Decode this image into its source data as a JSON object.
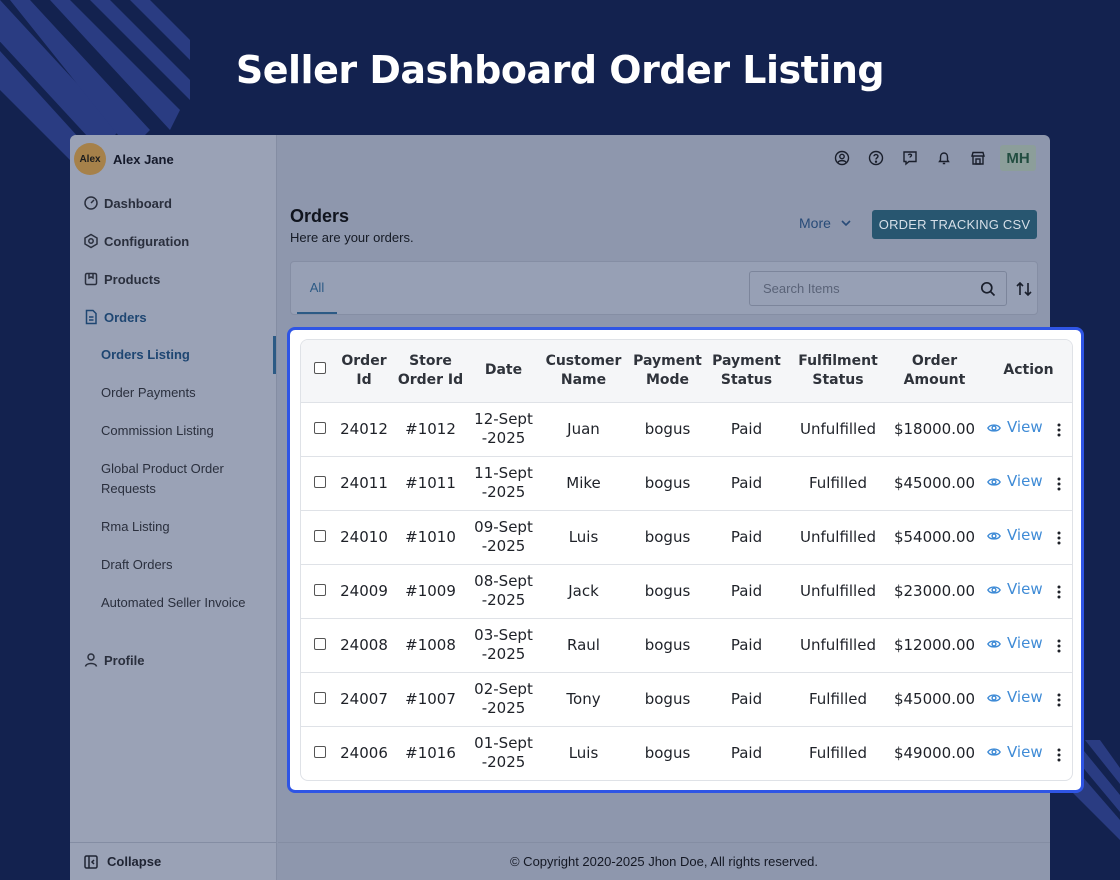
{
  "page": {
    "title": "Seller Dashboard Order Listing",
    "background": "#13224f",
    "highlight_color": "#2f55e5"
  },
  "sidebar": {
    "user": {
      "avatar_text": "Alex",
      "name": "Alex Jane"
    },
    "items": [
      {
        "label": "Dashboard",
        "icon": "dashboard-icon"
      },
      {
        "label": "Configuration",
        "icon": "gear-icon"
      },
      {
        "label": "Products",
        "icon": "product-icon"
      },
      {
        "label": "Orders",
        "icon": "document-icon"
      }
    ],
    "orders_subitems": [
      "Orders Listing",
      "Order Payments",
      "Commission Listing",
      "Global Product Order Requests",
      "Rma Listing",
      "Draft Orders",
      "Automated Seller Invoice"
    ],
    "profile_label": "Profile",
    "collapse_label": "Collapse"
  },
  "topbar": {
    "icons": [
      "user-circle-icon",
      "help-icon",
      "feedback-icon",
      "bell-icon",
      "store-icon"
    ],
    "user_initials": "MH"
  },
  "orders": {
    "title": "Orders",
    "subtitle": "Here are your orders.",
    "more_label": "More",
    "csv_label": "ORDER TRACKING CSV",
    "tab_all": "All",
    "search_placeholder": "Search Items"
  },
  "table": {
    "headers": {
      "order_id": "Order Id",
      "store_order_id": "Store Order Id",
      "date": "Date",
      "customer_name": "Customer Name",
      "payment_mode": "Payment Mode",
      "payment_status": "Payment Status",
      "fulfilment_status": "Fulfilment Status",
      "order_amount": "Order Amount",
      "action": "Action"
    },
    "view_label": "View",
    "rows": [
      {
        "order_id": "24012",
        "store_order_id": "#1012",
        "date": "12-Sept -2025",
        "customer": "Juan",
        "payment_mode": "bogus",
        "payment_status": "Paid",
        "fulfilment": "Unfulfilled",
        "amount": "$18000.00"
      },
      {
        "order_id": "24011",
        "store_order_id": "#1011",
        "date": "11-Sept -2025",
        "customer": "Mike",
        "payment_mode": "bogus",
        "payment_status": "Paid",
        "fulfilment": "Fulfilled",
        "amount": "$45000.00"
      },
      {
        "order_id": "24010",
        "store_order_id": "#1010",
        "date": "09-Sept -2025",
        "customer": "Luis",
        "payment_mode": "bogus",
        "payment_status": "Paid",
        "fulfilment": "Unfulfilled",
        "amount": "$54000.00"
      },
      {
        "order_id": "24009",
        "store_order_id": "#1009",
        "date": "08-Sept -2025",
        "customer": "Jack",
        "payment_mode": "bogus",
        "payment_status": "Paid",
        "fulfilment": "Unfulfilled",
        "amount": "$23000.00"
      },
      {
        "order_id": "24008",
        "store_order_id": "#1008",
        "date": "03-Sept -2025",
        "customer": "Raul",
        "payment_mode": "bogus",
        "payment_status": "Paid",
        "fulfilment": "Unfulfilled",
        "amount": "$12000.00"
      },
      {
        "order_id": "24007",
        "store_order_id": "#1007",
        "date": "02-Sept -2025",
        "customer": "Tony",
        "payment_mode": "bogus",
        "payment_status": "Paid",
        "fulfilment": "Fulfilled",
        "amount": "$45000.00"
      },
      {
        "order_id": "24006",
        "store_order_id": "#1016",
        "date": "01-Sept -2025",
        "customer": "Luis",
        "payment_mode": "bogus",
        "payment_status": "Paid",
        "fulfilment": "Fulfilled",
        "amount": "$49000.00"
      }
    ]
  },
  "footer": {
    "copyright": "© Copyright 2020-2025 Jhon Doe, All rights reserved."
  }
}
